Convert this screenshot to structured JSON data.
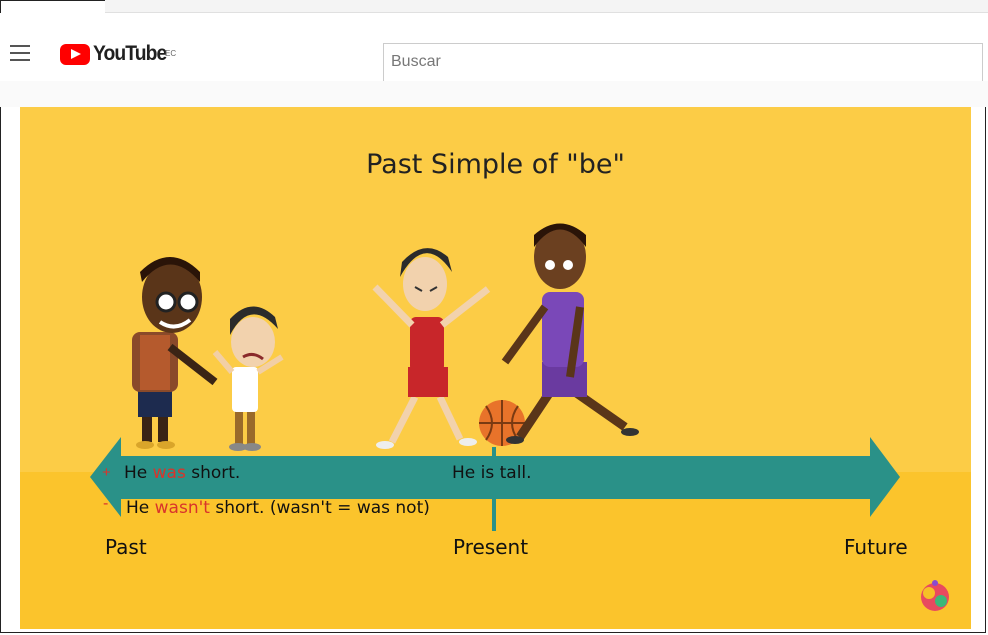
{
  "app": {
    "name": "YouTube",
    "country_code": "EC"
  },
  "search": {
    "placeholder": "Buscar"
  },
  "icons": {
    "menu": "hamburger-menu-icon",
    "logo": "youtube-play-icon",
    "channel_logo": "colorful-globe-icon"
  },
  "video": {
    "title": "Past Simple of \"be\"",
    "timeline": {
      "past_label": "Past",
      "present_label": "Present",
      "future_label": "Future"
    },
    "sentences": {
      "positive": {
        "sign": "+",
        "before": "He ",
        "verb": "was",
        "after": " short."
      },
      "present": "He is tall.",
      "negative": {
        "sign": "-",
        "before": "He ",
        "verb": "wasn't",
        "after": " short.  (wasn't = was not)"
      }
    },
    "colors": {
      "background": "#fccc46",
      "ground": "#fbc42c",
      "arrow": "#2a9188",
      "highlight": "#d9342b"
    }
  }
}
